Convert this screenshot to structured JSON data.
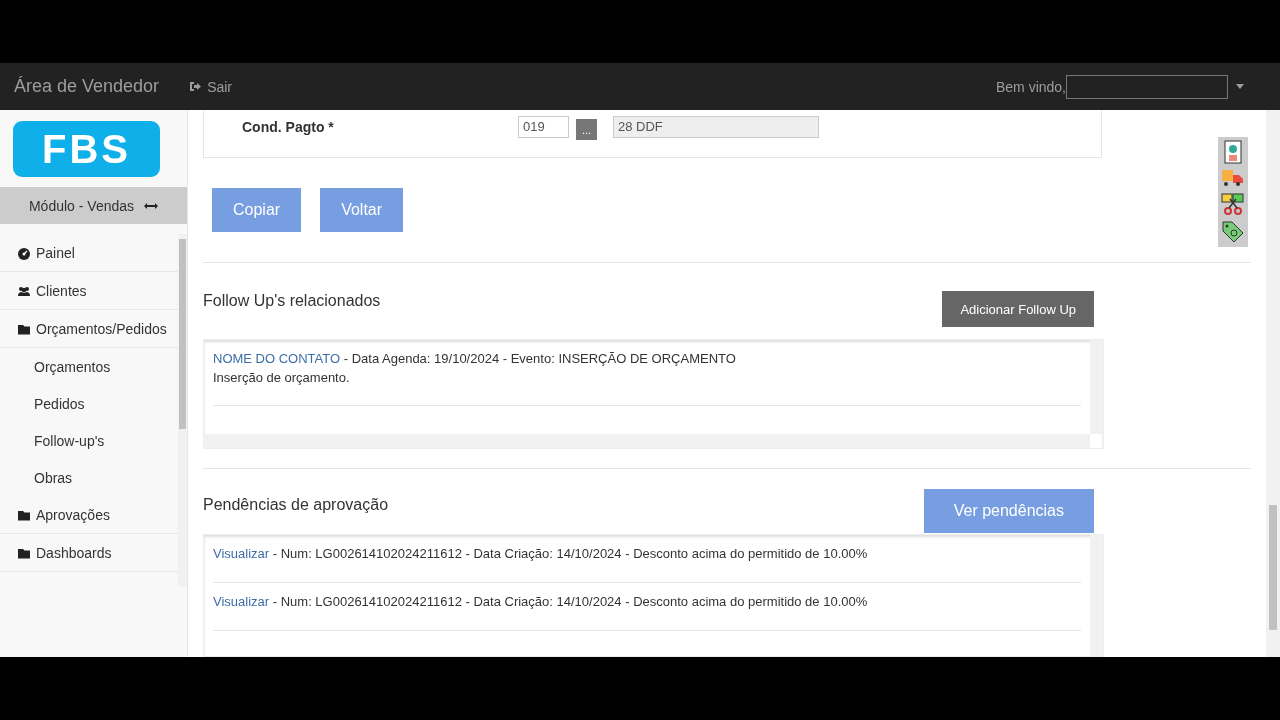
{
  "navbar": {
    "title": "Área de Vendedor",
    "logout": "Sair",
    "welcome": "Bem vindo,"
  },
  "sidebar": {
    "logo": "FBS",
    "module": "Módulo - Vendas",
    "items": [
      {
        "label": "Painel",
        "kind": "gauge"
      },
      {
        "label": "Clientes",
        "kind": "users"
      },
      {
        "label": "Orçamentos/Pedidos",
        "kind": "folder",
        "children": [
          {
            "label": "Orçamentos"
          },
          {
            "label": "Pedidos"
          },
          {
            "label": "Follow-up's"
          },
          {
            "label": "Obras"
          }
        ]
      },
      {
        "label": "Aprovações",
        "kind": "folder"
      },
      {
        "label": "Dashboards",
        "kind": "folder"
      }
    ]
  },
  "form": {
    "label": "Cond. Pagto *",
    "code": "019",
    "lookup_button": "...",
    "description": "28 DDF"
  },
  "actions": [
    "Copiar",
    "Voltar"
  ],
  "follow_ups": {
    "title": "Follow Up's relacionados",
    "button": "Adicionar Follow Up",
    "entries": [
      {
        "contact": "NOME DO CONTATO",
        "details": " - Data Agenda: 19/10/2024 - Evento: INSERÇÃO DE ORÇAMENTO",
        "note": "Inserção de orçamento."
      }
    ]
  },
  "approvals": {
    "title": "Pendências de aprovação",
    "button": "Ver pendências",
    "entries": [
      {
        "link": "Visualizar",
        "details": " - Num: LG002614102024211612 - Data Criação: 14/10/2024 - Desconto acima do permitido de 10.00%"
      },
      {
        "link": "Visualizar",
        "details": " - Num: LG002614102024211612 - Data Criação: 14/10/2024 - Desconto acima do permitido de 10.00%"
      }
    ]
  }
}
